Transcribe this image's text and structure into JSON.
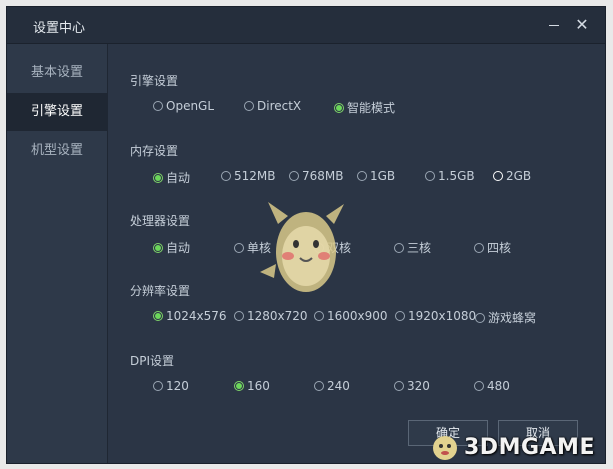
{
  "window": {
    "title": "设置中心",
    "minimize_icon": "minimize-icon",
    "close_icon": "close-icon",
    "close_glyph": "✕"
  },
  "sidebar": {
    "items": [
      {
        "label": "基本设置",
        "active": false
      },
      {
        "label": "引擎设置",
        "active": true
      },
      {
        "label": "机型设置",
        "active": false
      }
    ]
  },
  "engine": {
    "title": "引擎设置",
    "options": [
      "OpenGL",
      "DirectX",
      "智能模式"
    ],
    "selected": "智能模式"
  },
  "memory": {
    "title": "内存设置",
    "options": [
      "自动",
      "512MB",
      "768MB",
      "1GB",
      "1.5GB",
      "2GB"
    ],
    "selected": "自动"
  },
  "cpu": {
    "title": "处理器设置",
    "options": [
      "自动",
      "单核",
      "双核",
      "三核",
      "四核"
    ],
    "selected": "自动"
  },
  "resolution": {
    "title": "分辨率设置",
    "options": [
      "1024x576",
      "1280x720",
      "1600x900",
      "1920x1080",
      "游戏蜂窝"
    ],
    "selected": "1024x576"
  },
  "dpi": {
    "title": "DPI设置",
    "options": [
      "120",
      "160",
      "240",
      "320",
      "480"
    ],
    "selected": "160"
  },
  "buttons": {
    "ok": "确定",
    "cancel": "取消"
  },
  "watermark": {
    "text": "3DMGAME"
  },
  "colors": {
    "window_bg": "#2b3545",
    "accent_green": "#6cd85a"
  }
}
